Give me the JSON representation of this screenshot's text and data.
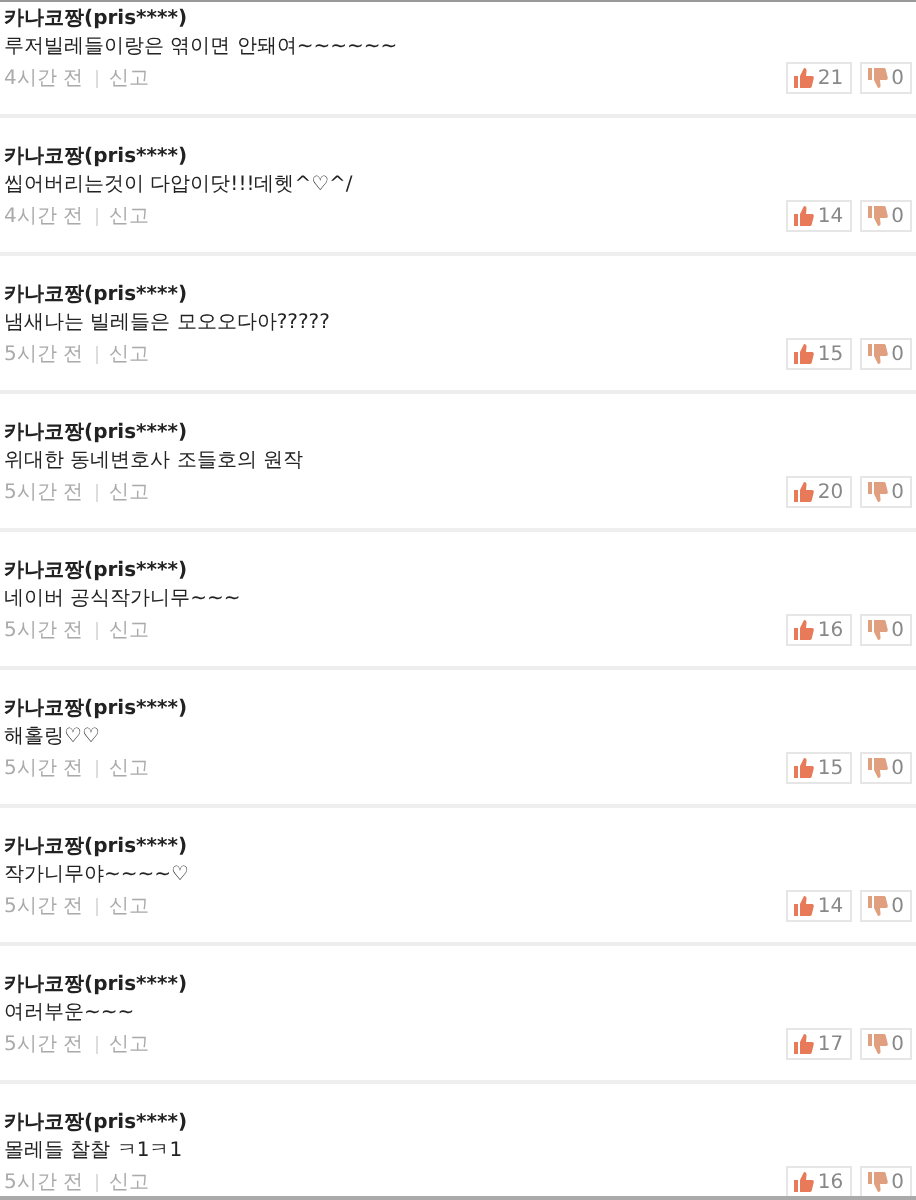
{
  "comments": [
    {
      "author": "카나코짱(pris****)",
      "text": "루저빌레들이랑은 엮이면 안돼여~~~~~~",
      "time": "4시간 전",
      "report": "신고",
      "likes": "21",
      "dislikes": "0"
    },
    {
      "author": "카나코짱(pris****)",
      "text": "씹어버리는것이 다압이닷!!!데헷^♡^/",
      "time": "4시간 전",
      "report": "신고",
      "likes": "14",
      "dislikes": "0"
    },
    {
      "author": "카나코짱(pris****)",
      "text": "냄새나는 빌레들은 모오오다아?????",
      "time": "5시간 전",
      "report": "신고",
      "likes": "15",
      "dislikes": "0"
    },
    {
      "author": "카나코짱(pris****)",
      "text": "위대한 동네변호사 조들호의 원작",
      "time": "5시간 전",
      "report": "신고",
      "likes": "20",
      "dislikes": "0"
    },
    {
      "author": "카나코짱(pris****)",
      "text": "네이버 공식작가니무~~~",
      "time": "5시간 전",
      "report": "신고",
      "likes": "16",
      "dislikes": "0"
    },
    {
      "author": "카나코짱(pris****)",
      "text": "해홀링♡♡",
      "time": "5시간 전",
      "report": "신고",
      "likes": "15",
      "dislikes": "0"
    },
    {
      "author": "카나코짱(pris****)",
      "text": "작가니무야~~~~♡",
      "time": "5시간 전",
      "report": "신고",
      "likes": "14",
      "dislikes": "0"
    },
    {
      "author": "카나코짱(pris****)",
      "text": "여러부운~~~",
      "time": "5시간 전",
      "report": "신고",
      "likes": "17",
      "dislikes": "0"
    },
    {
      "author": "카나코짱(pris****)",
      "text": "몰레들 찰찰 ㅋ1ㅋ1",
      "time": "5시간 전",
      "report": "신고",
      "likes": "16",
      "dislikes": "0"
    }
  ]
}
